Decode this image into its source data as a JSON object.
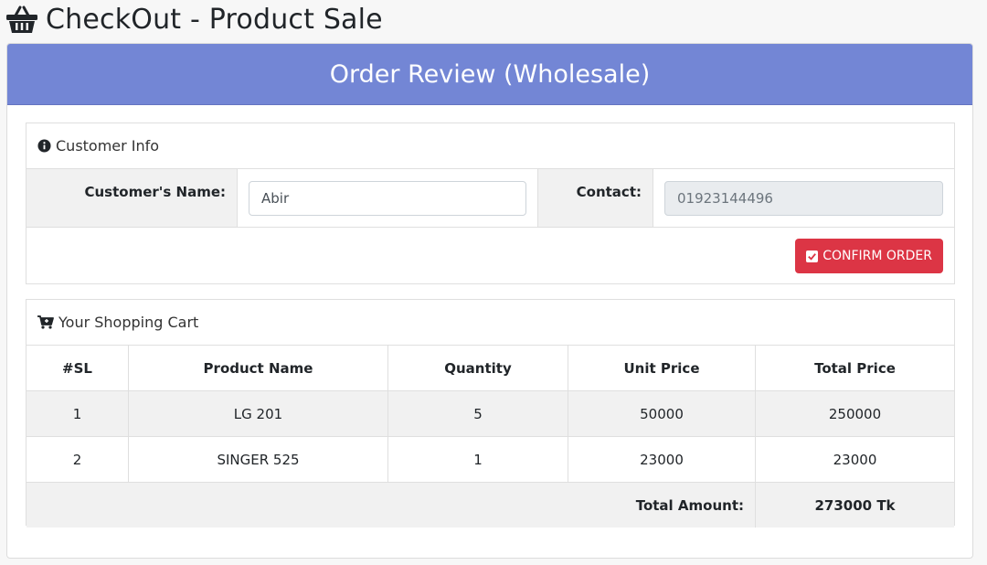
{
  "page": {
    "title": "CheckOut - Product Sale",
    "icon": "basket-icon"
  },
  "card": {
    "title": "Order Review (Wholesale)",
    "header_color": "#7386d5"
  },
  "customer_info": {
    "heading": "Customer Info",
    "icon": "info-circle-icon",
    "name_label": "Customer's Name:",
    "name_value": "Abir",
    "contact_label": "Contact:",
    "contact_value": "01923144496",
    "confirm_label": "CONFIRM ORDER",
    "confirm_color": "#dc3545"
  },
  "cart": {
    "heading": "Your Shopping Cart",
    "icon": "cart-icon",
    "columns": [
      "#SL",
      "Product Name",
      "Quantity",
      "Unit Price",
      "Total Price"
    ],
    "rows": [
      {
        "sl": "1",
        "product": "LG 201",
        "quantity": "5",
        "unit_price": "50000",
        "total_price": "250000"
      },
      {
        "sl": "2",
        "product": "SINGER 525",
        "quantity": "1",
        "unit_price": "23000",
        "total_price": "23000"
      }
    ],
    "total_label": "Total Amount:",
    "total_value": "273000 Tk"
  }
}
